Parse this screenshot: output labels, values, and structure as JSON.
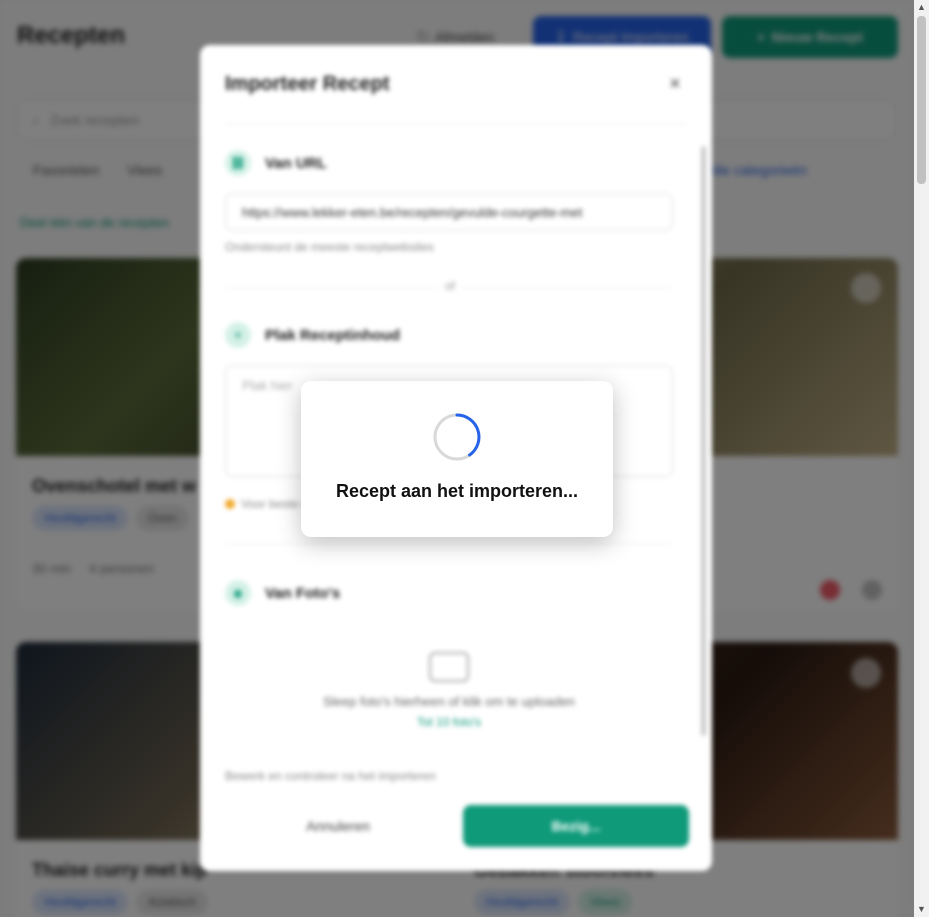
{
  "background_page": {
    "title": "Recepten",
    "header_buttons": {
      "ghost": "Afmelden",
      "blue": "Recept Importeren",
      "green": "Nieuw Recept"
    },
    "search_placeholder": "Zoek recepten",
    "filters": [
      "Favorieten",
      "Vlees"
    ],
    "filters_right": "Alle categorieën",
    "count_text": "Deel één van de recepten",
    "cards": [
      {
        "title": "Ovenschotel met w",
        "tags": [
          "Hoofdgerecht",
          "Oven"
        ],
        "meta": [
          "30 min",
          "4 personen"
        ]
      },
      {
        "title": "",
        "tags": [],
        "meta": []
      },
      {
        "title": "Thaise curry met kip",
        "tags": [
          "Hoofdgerecht",
          "Aziatisch"
        ],
        "meta": []
      },
      {
        "title": "Gebakken stoofvlees",
        "tags": [
          "Hoofdgerecht",
          "Vlees"
        ],
        "meta": []
      }
    ]
  },
  "import_modal": {
    "title": "Importeer Recept",
    "close_icon": "×",
    "url_section": {
      "heading": "Van URL",
      "value": "https://www.lekker-eten.be/recepten/gevulde-courgette-met",
      "hint": "Ondersteunt de meeste receptwebsites"
    },
    "separator_text": "of",
    "text_section": {
      "heading": "Plak Receptinhoud",
      "placeholder": "Plak hier",
      "warning": "Voor beste resultaten"
    },
    "photo_section": {
      "heading": "Van Foto's",
      "dropzone_text": "Sleep foto's hierheen of klik om te uploaden",
      "dropzone_link": "Tot 10 foto's",
      "hint": "Bewerk en controleer na het importeren"
    },
    "buttons": {
      "cancel": "Annuleren",
      "import": "Bezig..."
    }
  },
  "loading_dialog": {
    "message": "Recept aan het importeren..."
  },
  "colors": {
    "accent_green": "#0f9a7a",
    "accent_blue": "#2563eb",
    "spinner_track": "#d9d9d9",
    "spinner_arc": "#2563eb"
  }
}
